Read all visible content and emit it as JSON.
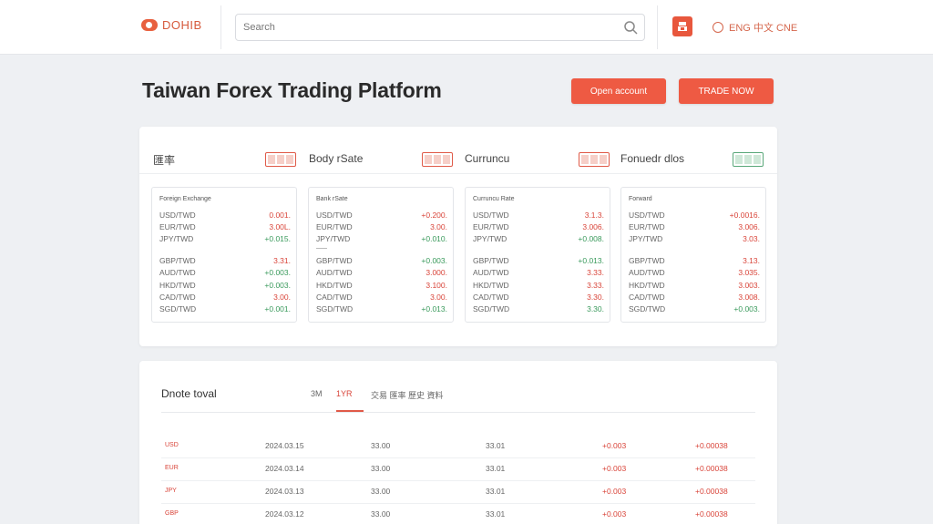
{
  "topbar": {
    "logo_text": "DOHIB",
    "search": {
      "value": "Search",
      "placeholder": "Search"
    },
    "lang_label": "ENG 中文 CNE"
  },
  "header": {
    "title": "Taiwan Forex Trading Platform",
    "btn_primary": "Open account",
    "btn_secondary": "TRADE NOW"
  },
  "rates": {
    "tabs": [
      {
        "label": "匯率"
      },
      {
        "label": "Body rSate"
      },
      {
        "label": "Curruncu"
      },
      {
        "label": "Fonuedr dlos"
      }
    ],
    "panels": [
      {
        "title": "Foreign Exchange",
        "rows": [
          {
            "label": "USD/TWD",
            "value": "0.001.",
            "tone": "red"
          },
          {
            "label": "EUR/TWD",
            "value": "3.00L.",
            "tone": "red"
          },
          {
            "label": "JPY/TWD",
            "value": "+0.015.",
            "tone": "green"
          },
          {
            "label": "GBP/TWD",
            "value": "3.31.",
            "tone": "red"
          },
          {
            "label": "AUD/TWD",
            "value": "+0.003.",
            "tone": "green"
          },
          {
            "label": "HKD/TWD",
            "value": "+0.003.",
            "tone": "green"
          },
          {
            "label": "CAD/TWD",
            "value": "3.00.",
            "tone": "red"
          },
          {
            "label": "SGD/TWD",
            "value": "+0.001.",
            "tone": "green"
          }
        ]
      },
      {
        "title": "Bank rSate",
        "rows": [
          {
            "label": "USD/TWD",
            "value": "+0.200.",
            "tone": "red"
          },
          {
            "label": "EUR/TWD",
            "value": "3.00.",
            "tone": "red"
          },
          {
            "label": "JPY/TWD",
            "value": "+0.010.",
            "tone": "green"
          },
          {
            "label": "GBP/TWD",
            "value": "+0.003.",
            "tone": "green"
          },
          {
            "label": "AUD/TWD",
            "value": "3.000.",
            "tone": "red"
          },
          {
            "label": "HKD/TWD",
            "value": "3.100.",
            "tone": "red"
          },
          {
            "label": "CAD/TWD",
            "value": "3.00.",
            "tone": "red"
          },
          {
            "label": "SGD/TWD",
            "value": "+0.013.",
            "tone": "green"
          }
        ]
      },
      {
        "title": "Curruncu Rate",
        "rows": [
          {
            "label": "USD/TWD",
            "value": "3.1.3.",
            "tone": "red"
          },
          {
            "label": "EUR/TWD",
            "value": "3.006.",
            "tone": "red"
          },
          {
            "label": "JPY/TWD",
            "value": "+0.008.",
            "tone": "green"
          },
          {
            "label": "GBP/TWD",
            "value": "+0.013.",
            "tone": "green"
          },
          {
            "label": "AUD/TWD",
            "value": "3.33.",
            "tone": "red"
          },
          {
            "label": "HKD/TWD",
            "value": "3.33.",
            "tone": "red"
          },
          {
            "label": "CAD/TWD",
            "value": "3.30.",
            "tone": "red"
          },
          {
            "label": "SGD/TWD",
            "value": "3.30.",
            "tone": "green"
          }
        ]
      },
      {
        "title": "Forward",
        "rows": [
          {
            "label": "USD/TWD",
            "value": "+0.0016.",
            "tone": "red"
          },
          {
            "label": "EUR/TWD",
            "value": "3.006.",
            "tone": "red"
          },
          {
            "label": "JPY/TWD",
            "value": "3.03.",
            "tone": "red"
          },
          {
            "label": "GBP/TWD",
            "value": "3.13.",
            "tone": "red"
          },
          {
            "label": "AUD/TWD",
            "value": "3.035.",
            "tone": "red"
          },
          {
            "label": "HKD/TWD",
            "value": "3.003.",
            "tone": "red"
          },
          {
            "label": "CAD/TWD",
            "value": "3.008.",
            "tone": "red"
          },
          {
            "label": "SGD/TWD",
            "value": "+0.003.",
            "tone": "green"
          }
        ]
      }
    ]
  },
  "history": {
    "title": "Dnote toval",
    "tabs": [
      "3M",
      "1YR",
      "交易 匯率 歷史 資料"
    ],
    "rows": [
      {
        "c0": "USD",
        "c1": "2024.03.15",
        "c2": "33.00",
        "c3": "33.01",
        "c4": "+0.003",
        "c5": "+0.00038"
      },
      {
        "c0": "EUR",
        "c1": "2024.03.14",
        "c2": "33.00",
        "c3": "33.01",
        "c4": "+0.003",
        "c5": "+0.00038"
      },
      {
        "c0": "JPY",
        "c1": "2024.03.13",
        "c2": "33.00",
        "c3": "33.01",
        "c4": "+0.003",
        "c5": "+0.00038"
      },
      {
        "c0": "GBP",
        "c1": "2024.03.12",
        "c2": "33.00",
        "c3": "33.01",
        "c4": "+0.003",
        "c5": "+0.00038"
      }
    ]
  },
  "colors": {
    "accent": "#ee5a43",
    "up": "#d9453a",
    "down": "#3a9a5c"
  }
}
